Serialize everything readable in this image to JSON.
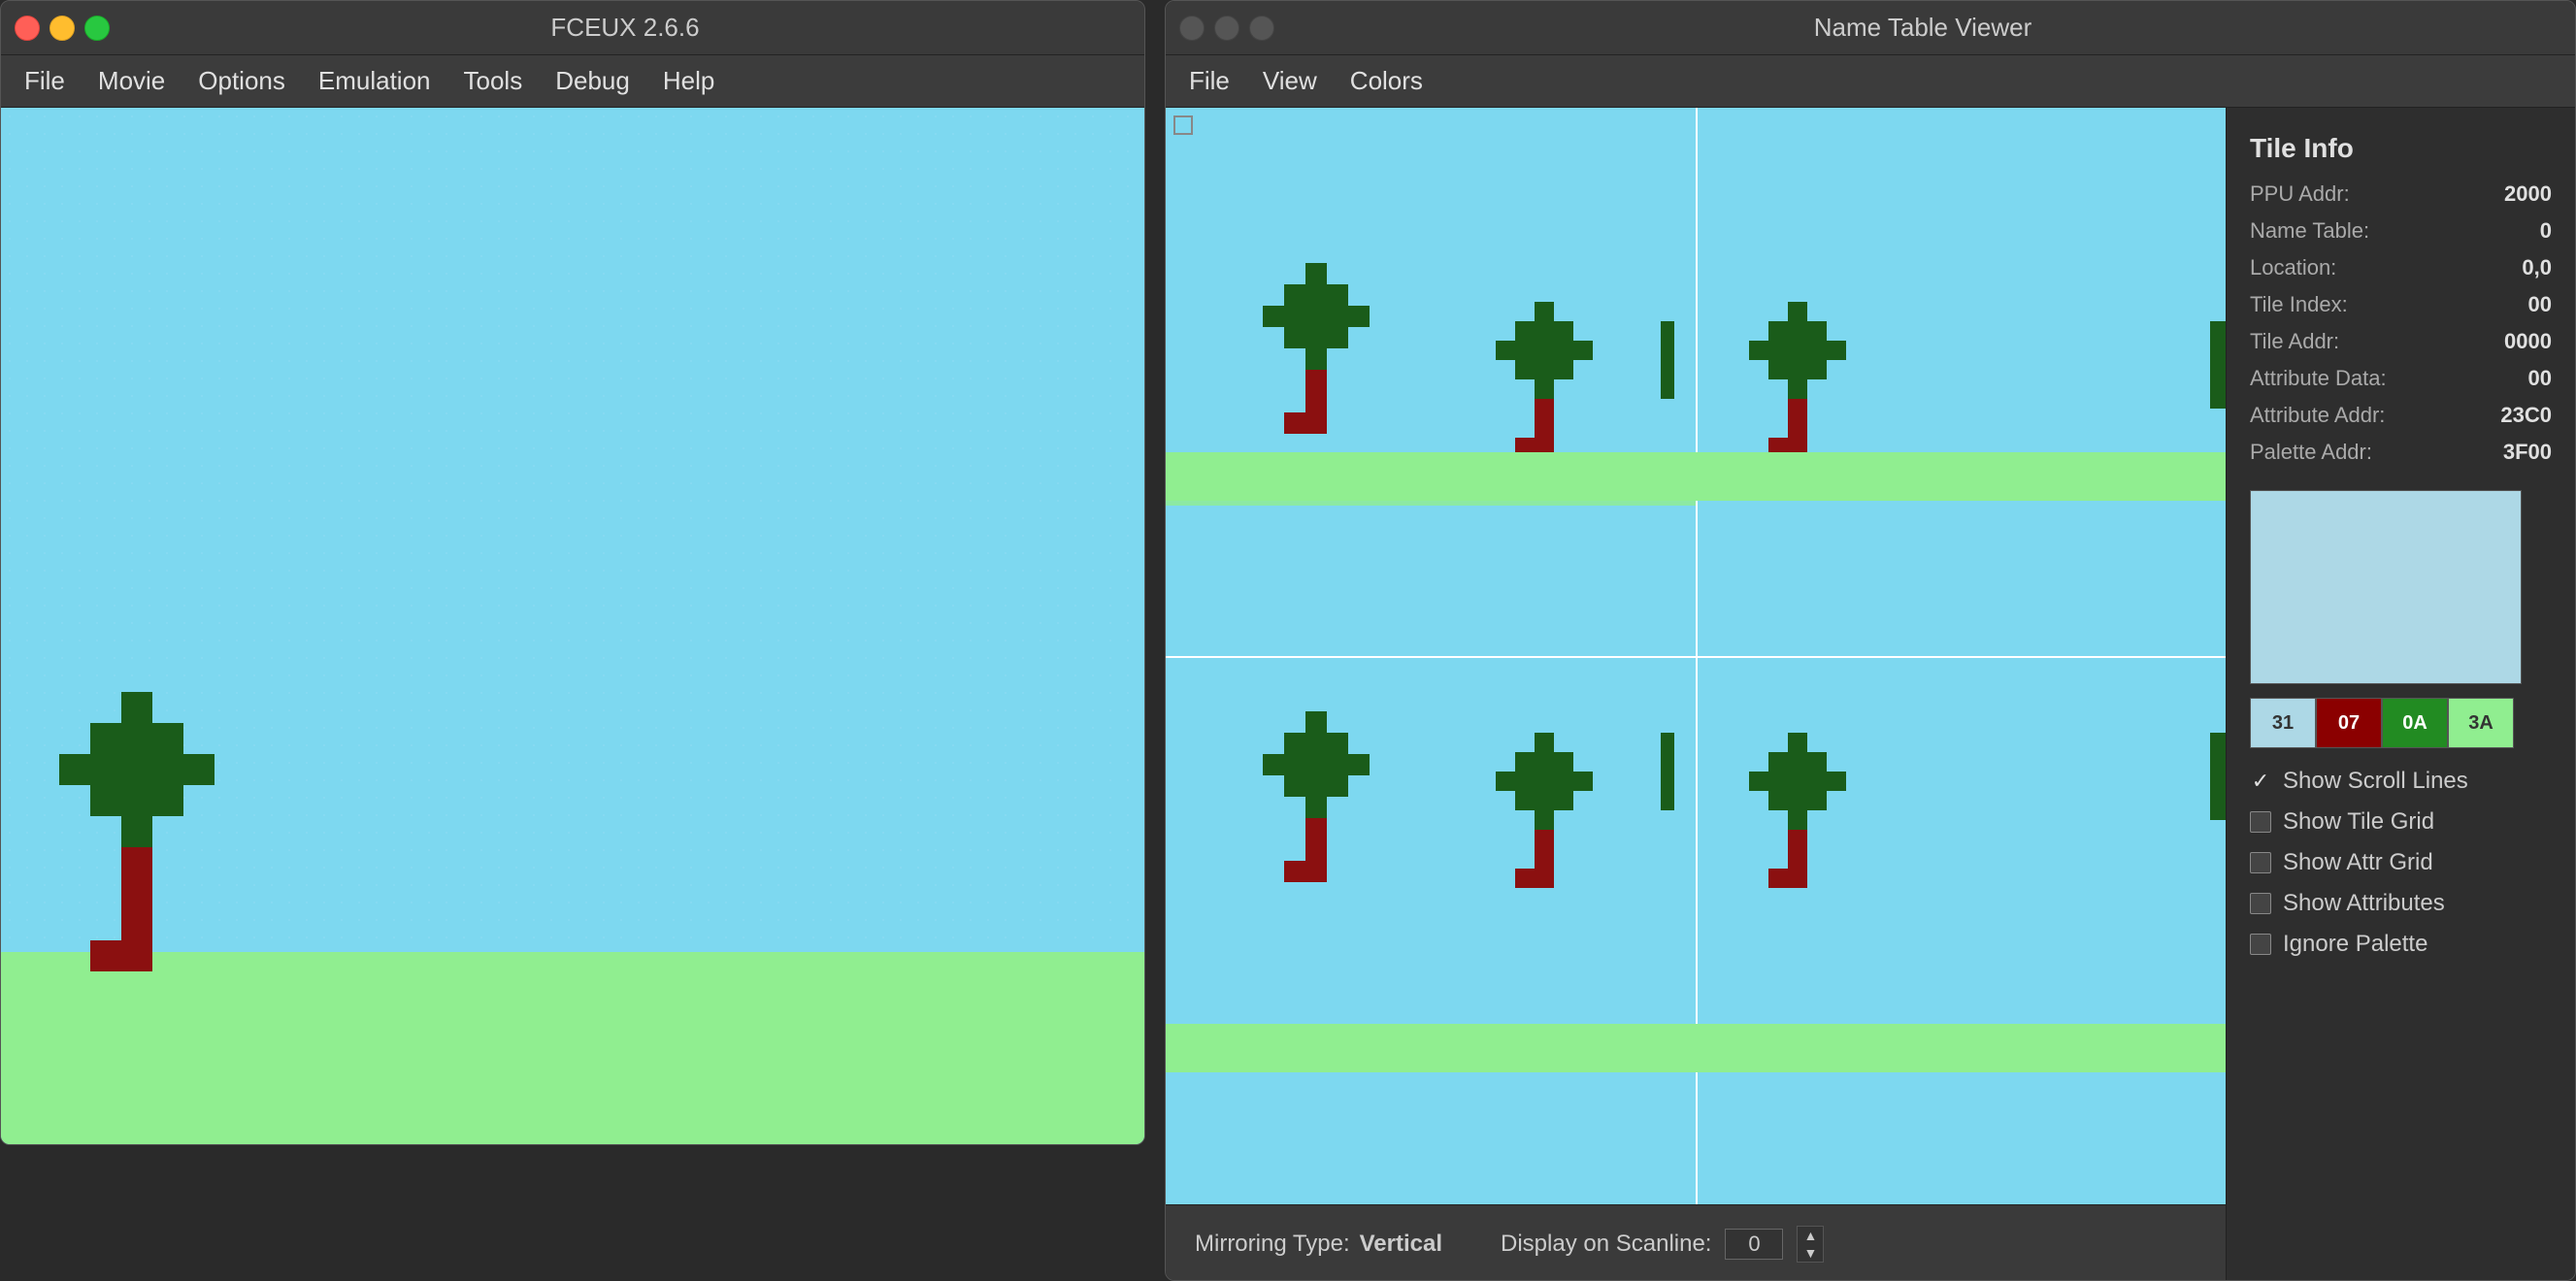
{
  "fceux": {
    "title": "FCEUX 2.6.6",
    "menu": {
      "items": [
        "File",
        "Movie",
        "Options",
        "Emulation",
        "Tools",
        "Debug",
        "Help"
      ]
    }
  },
  "nametable": {
    "title": "Name Table Viewer",
    "menu": {
      "items": [
        "File",
        "View",
        "Colors"
      ]
    },
    "tile_info": {
      "section_title": "Tile Info",
      "ppu_addr_label": "PPU Addr:",
      "ppu_addr_value": "2000",
      "name_table_label": "Name Table:",
      "name_table_value": "0",
      "location_label": "Location:",
      "location_value": "0,0",
      "tile_index_label": "Tile Index:",
      "tile_index_value": "00",
      "tile_addr_label": "Tile Addr:",
      "tile_addr_value": "0000",
      "attr_data_label": "Attribute Data:",
      "attr_data_value": "00",
      "attr_addr_label": "Attribute Addr:",
      "attr_addr_value": "23C0",
      "palette_addr_label": "Palette Addr:",
      "palette_addr_value": "3F00"
    },
    "palette_swatches": [
      {
        "value": "31",
        "color": "#add8e6"
      },
      {
        "value": "07",
        "color": "#8b0000"
      },
      {
        "value": "0A",
        "color": "#228b22"
      },
      {
        "value": "3A",
        "color": "#90ee90"
      }
    ],
    "checkboxes": [
      {
        "label": "Show Scroll Lines",
        "checked": true
      },
      {
        "label": "Show Tile Grid",
        "checked": false
      },
      {
        "label": "Show Attr Grid",
        "checked": false
      },
      {
        "label": "Show Attributes",
        "checked": false
      },
      {
        "label": "Ignore Palette",
        "checked": false
      }
    ],
    "status": {
      "mirroring_label": "Mirroring Type:",
      "mirroring_value": "Vertical",
      "scanline_label": "Display on Scanline:",
      "scanline_value": "0"
    }
  }
}
